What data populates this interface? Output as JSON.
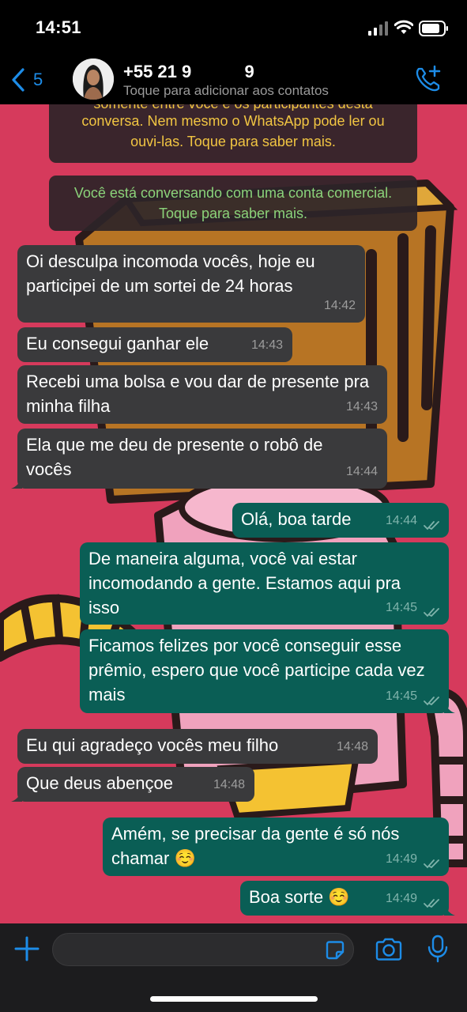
{
  "status": {
    "time": "14:51"
  },
  "header": {
    "back_count": "5",
    "contact_name": "+55 21 9           9",
    "contact_subtitle": "Toque para adicionar aos contatos"
  },
  "system_messages": {
    "encryption": "somente entre você e os participantes desta conversa. Nem mesmo o WhatsApp pode ler ou ouvi-las. Toque para saber mais.",
    "encryption_line1": "somente entre você e os participantes desta",
    "encryption_line2": "conversa. Nem mesmo o WhatsApp pode ler ou",
    "encryption_line3": "ouvi-las. Toque para saber mais.",
    "business_line1": "Você está conversando com uma conta comercial.",
    "business_line2": "Toque para saber mais."
  },
  "messages": [
    {
      "dir": "in",
      "text": "Oi desculpa incomoda vocês, hoje eu participei de um sortei de 24 horas",
      "time": "14:42"
    },
    {
      "dir": "in",
      "text": "Eu consegui ganhar ele",
      "time": "14:43"
    },
    {
      "dir": "in",
      "text": "Recebi uma bolsa e vou dar de presente pra minha filha",
      "time": "14:43"
    },
    {
      "dir": "in",
      "text": "Ela que me deu de presente o robô de vocês",
      "time": "14:44"
    },
    {
      "dir": "out",
      "text": "Olá, boa tarde",
      "time": "14:44"
    },
    {
      "dir": "out",
      "text": "De maneira alguma, você vai estar incomodando a gente. Estamos aqui pra isso",
      "time": "14:45"
    },
    {
      "dir": "out",
      "text": "Ficamos felizes por você conseguir esse prêmio, espero que você participe cada vez mais",
      "time": "14:45"
    },
    {
      "dir": "in",
      "text": "Eu qui agradeço vocês meu filho",
      "time": "14:48"
    },
    {
      "dir": "in",
      "text": "Que deus abençoe",
      "time": "14:48"
    },
    {
      "dir": "out",
      "text": "Amém, se precisar da gente é só nós chamar ☺️",
      "time": "14:49"
    },
    {
      "dir": "out",
      "text": "Boa sorte ☺️",
      "time": "14:49"
    }
  ],
  "colors": {
    "chat_background": "#d63a5c",
    "incoming_bubble": "#3a3a3c",
    "outgoing_bubble": "#0a5e55",
    "accent": "#1d8ce7"
  },
  "icons": [
    "back-chevron-icon",
    "add-call-icon",
    "plus-icon",
    "sticker-icon",
    "camera-icon",
    "mic-icon",
    "double-check-icon"
  ]
}
